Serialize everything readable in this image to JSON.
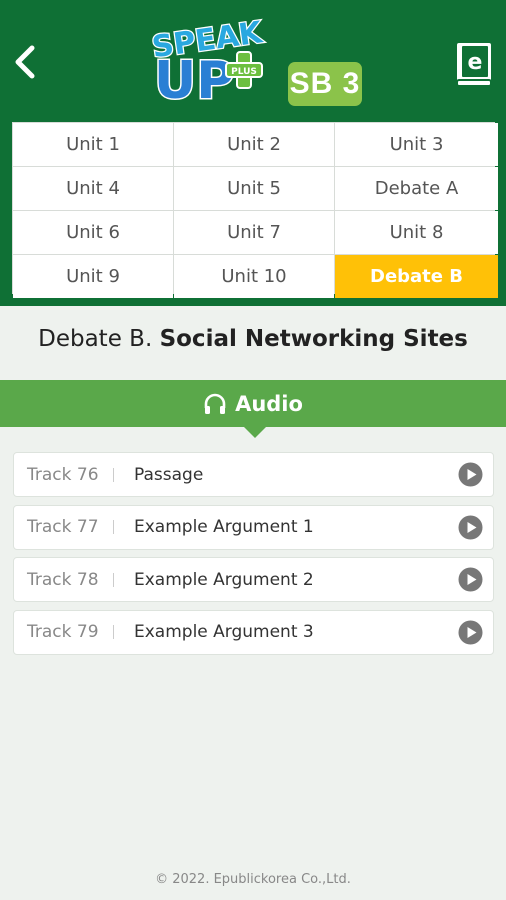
{
  "header": {
    "logo_text": "SPEAK UP PLUS",
    "badge": "SB 3",
    "back_icon": "chevron-left-icon",
    "ebook_icon": "ebook-icon",
    "colors": {
      "header_bg": "#0f7035",
      "badge_bg": "#8bc34a",
      "active_unit": "#ffc107"
    }
  },
  "units": [
    {
      "label": "Unit 1",
      "active": false
    },
    {
      "label": "Unit 2",
      "active": false
    },
    {
      "label": "Unit 3",
      "active": false
    },
    {
      "label": "Unit 4",
      "active": false
    },
    {
      "label": "Unit 5",
      "active": false
    },
    {
      "label": "Debate A",
      "active": false
    },
    {
      "label": "Unit 6",
      "active": false
    },
    {
      "label": "Unit 7",
      "active": false
    },
    {
      "label": "Unit 8",
      "active": false
    },
    {
      "label": "Unit 9",
      "active": false
    },
    {
      "label": "Unit 10",
      "active": false
    },
    {
      "label": "Debate B",
      "active": true
    }
  ],
  "page": {
    "title_prefix": "Debate B.",
    "title_main": "Social Networking Sites"
  },
  "audio_section": {
    "label": "Audio",
    "icon": "headphones-icon",
    "color": "#5aa84a"
  },
  "tracks": [
    {
      "number": "Track 76",
      "title": "Passage"
    },
    {
      "number": "Track 77",
      "title": "Example Argument 1"
    },
    {
      "number": "Track 78",
      "title": "Example Argument 2"
    },
    {
      "number": "Track 79",
      "title": "Example Argument 3"
    }
  ],
  "footer": {
    "copyright": "© 2022. Epublickorea Co.,Ltd."
  }
}
